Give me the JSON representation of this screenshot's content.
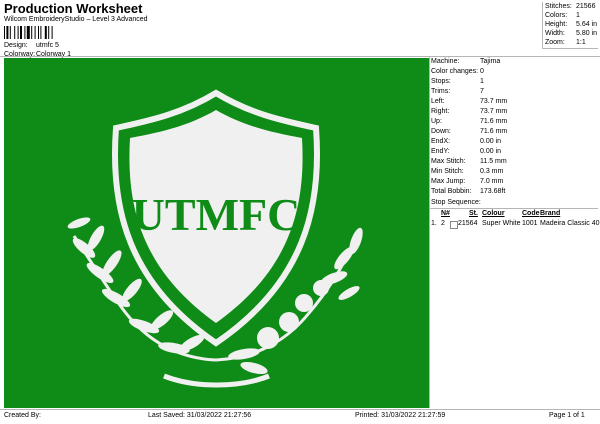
{
  "header": {
    "title": "Production Worksheet",
    "subtitle": "Wilcom EmbroideryStudio – Level 3 Advanced",
    "design_label": "Design:",
    "design_value": "utmfc 5",
    "colorway_label": "Colorway:",
    "colorway_value": "Colorway 1"
  },
  "summary": [
    {
      "label": "Stitches:",
      "value": "21566"
    },
    {
      "label": "Colors:",
      "value": "1"
    },
    {
      "label": "Height:",
      "value": "5.64 in"
    },
    {
      "label": "Width:",
      "value": "5.80 in"
    },
    {
      "label": "Zoom:",
      "value": "1:1"
    }
  ],
  "design": {
    "background_color": "#0f8c17",
    "thread_color": "#f0f0f0",
    "text": "UTMFC"
  },
  "details": [
    {
      "label": "Machine:",
      "value": "Tajima"
    },
    {
      "label": "Color changes:",
      "value": "0"
    },
    {
      "label": "Stops:",
      "value": "1"
    },
    {
      "label": "Trims:",
      "value": "7"
    },
    {
      "label": "Left:",
      "value": "73.7 mm"
    },
    {
      "label": "Right:",
      "value": "73.7 mm"
    },
    {
      "label": "Up:",
      "value": "71.6 mm"
    },
    {
      "label": "Down:",
      "value": "71.6 mm"
    },
    {
      "label": "EndX:",
      "value": "0.00 in"
    },
    {
      "label": "EndY:",
      "value": "0.00 in"
    },
    {
      "label": "Max Stitch:",
      "value": "11.5 mm"
    },
    {
      "label": "Min Stitch:",
      "value": "0.3 mm"
    },
    {
      "label": "Max Jump:",
      "value": "7.0 mm"
    },
    {
      "label": "Total Bobbin:",
      "value": "173.68ft"
    }
  ],
  "stop_sequence": {
    "label": "Stop Sequence:",
    "columns": [
      "N#",
      "St.",
      "Colour",
      "Code",
      "Brand"
    ],
    "rows": [
      {
        "index": "1.",
        "n": "2",
        "st": "21564",
        "colour": "Super White",
        "code": "1001",
        "brand": "Madeira Classic 40",
        "swatch": "#ffffff"
      }
    ]
  },
  "footer": {
    "created_by": "Created By:",
    "last_saved": "Last Saved: 31/03/2022 21:27:56",
    "printed": "Printed: 31/03/2022 21:27:59",
    "page": "Page 1 of 1"
  }
}
